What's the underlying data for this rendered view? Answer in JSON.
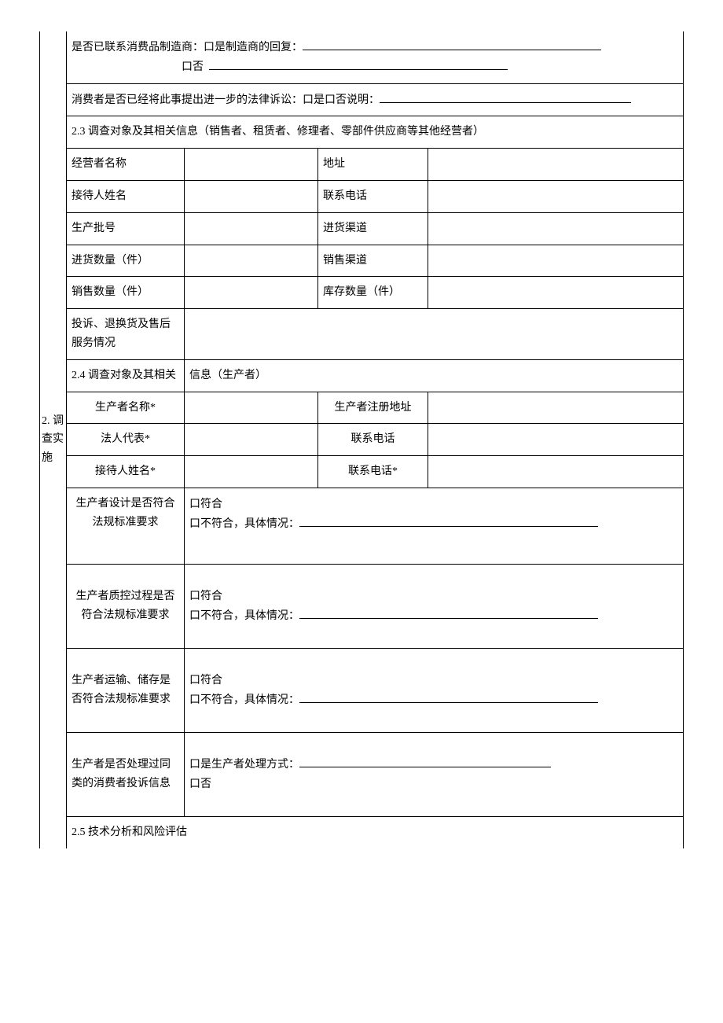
{
  "sideLabel": "2.\n调查实施",
  "row1": {
    "prefix": "是否已联系消费品制造商：",
    "yes": "口是制造商的回复：",
    "no": "口否"
  },
  "row2": {
    "prefix": "消费者是否已经将此事提出进一步的法律诉讼：",
    "opts": "口是口否说明："
  },
  "s23": "2.3 调查对象及其相关信息（销售者、租赁者、修理者、零部件供应商等其他经营者）",
  "r23_1a": "经营者名称",
  "r23_1b": "地址",
  "r23_2a": "接待人姓名",
  "r23_2b": "联系电话",
  "r23_3a": "生产批号",
  "r23_3b": "进货渠道",
  "r23_4a": "进货数量（件）",
  "r23_4b": "销售渠道",
  "r23_5a": "销售数量（件）",
  "r23_5b": "库存数量（件）",
  "r23_6a": "投诉、退换货及售后服务情况",
  "s24a": "2.4 调查对象及其相关",
  "s24b": "信息（生产者）",
  "r24_1a": "生产者名称*",
  "r24_1b": "生产者注册地址",
  "r24_2a": "法人代表*",
  "r24_2b": "联系电话",
  "r24_3a": "接待人姓名*",
  "r24_3b": "联系电话*",
  "r24_4a": "生产者设计是否符合法规标准要求",
  "r24_4b_line1": "口符合",
  "r24_4b_line2": "口不符合，具体情况：",
  "r24_5a": "生产者质控过程是否符合法规标准要求",
  "r24_6a": "生产者运输、储存是否符合法规标准要求",
  "r24_7a": "生产者是否处理过同类的消费者投诉信息",
  "r24_7b_line1": "口是生产者处理方式：",
  "r24_7b_line2": "口否",
  "s25": "2.5 技术分析和风险评估"
}
